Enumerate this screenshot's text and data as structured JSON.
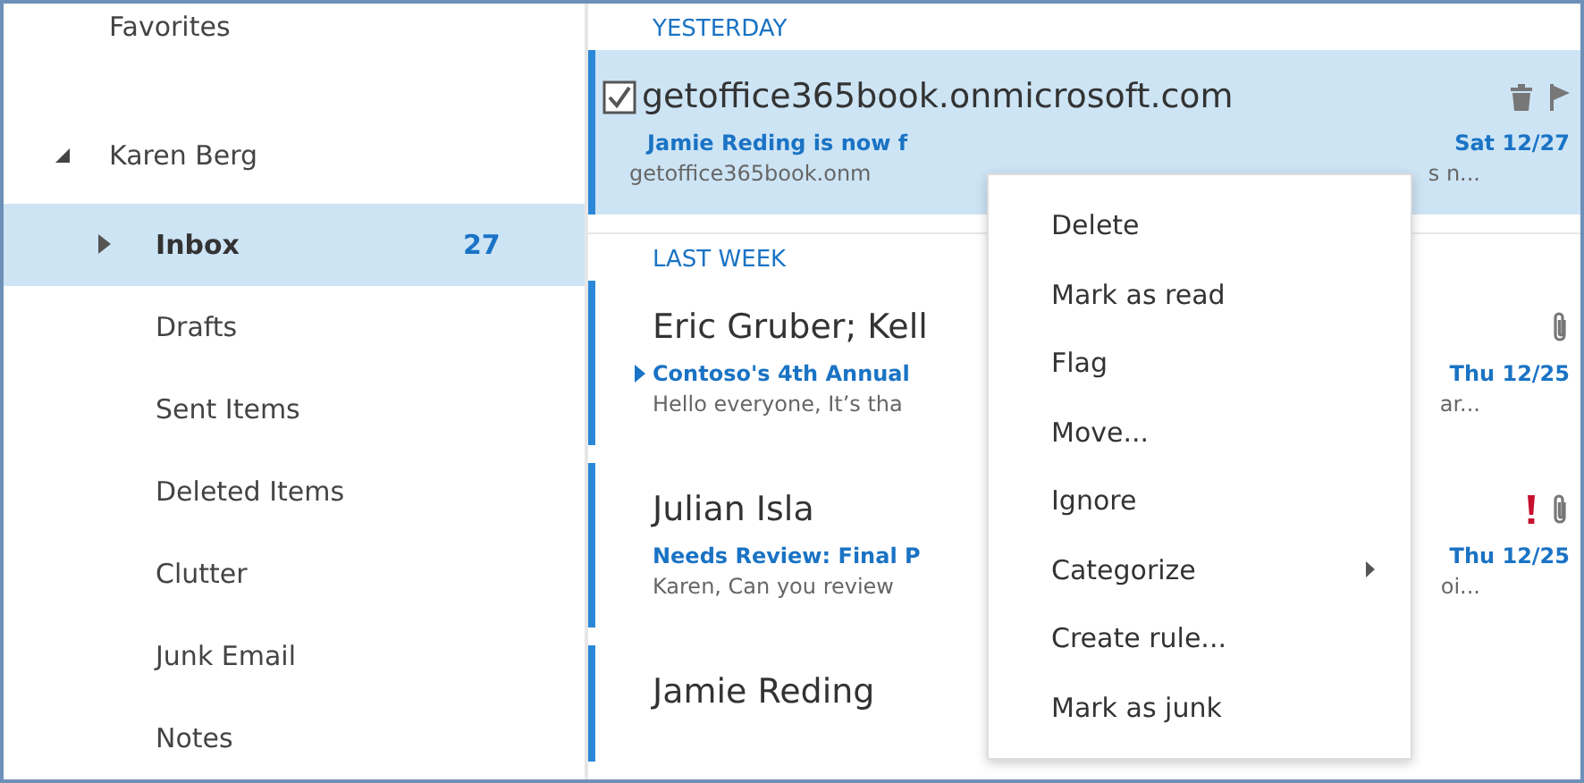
{
  "sidebar": {
    "favorites": "Favorites",
    "account": {
      "label": "Karen Berg",
      "expanded": true
    },
    "folders": [
      {
        "label": "Inbox",
        "count": "27",
        "selected": true,
        "has_children": true
      },
      {
        "label": "Drafts",
        "selected": false
      },
      {
        "label": "Sent Items",
        "selected": false
      },
      {
        "label": "Deleted Items",
        "selected": false
      },
      {
        "label": "Clutter",
        "selected": false
      },
      {
        "label": "Junk Email",
        "selected": false
      },
      {
        "label": "Notes",
        "selected": false
      }
    ]
  },
  "message_groups": [
    {
      "heading": "YESTERDAY",
      "messages": [
        {
          "sender": "getoffice365book.onmicrosoft.com",
          "subject": "Jamie Reding is now f",
          "preview_start": "getoffice365book.onm",
          "preview_end": "s n...",
          "date": "Sat 12/27",
          "selected": true,
          "checked": true,
          "thread": false,
          "icons": [
            {
              "kind": "trash"
            },
            {
              "kind": "flag"
            }
          ]
        }
      ]
    },
    {
      "heading": "LAST WEEK",
      "messages": [
        {
          "sender": "Eric Gruber; Kell",
          "subject": "Contoso's 4th Annual",
          "preview_start": "Hello everyone, It’s tha",
          "preview_end": "ar...",
          "date": "Thu 12/25",
          "selected": false,
          "checked": false,
          "thread": true,
          "icons": [
            {
              "kind": "attachment"
            }
          ]
        },
        {
          "sender": "Julian Isla",
          "subject": "Needs Review: Final P",
          "preview_start": "Karen, Can you review",
          "preview_end": "oi...",
          "date": "Thu 12/25",
          "selected": false,
          "checked": false,
          "thread": false,
          "icons": [
            {
              "kind": "important"
            },
            {
              "kind": "attachment"
            }
          ]
        },
        {
          "sender": "Jamie Reding",
          "selected": false,
          "checked": false
        }
      ]
    }
  ],
  "context_menu": [
    {
      "label": "Delete",
      "submenu": false
    },
    {
      "label": "Mark as read",
      "submenu": false
    },
    {
      "label": "Flag",
      "submenu": false
    },
    {
      "label": "Move...",
      "submenu": false
    },
    {
      "label": "Ignore",
      "submenu": false
    },
    {
      "label": "Categorize",
      "submenu": true
    },
    {
      "label": "Create rule...",
      "submenu": false
    },
    {
      "label": "Mark as junk",
      "submenu": false
    }
  ]
}
